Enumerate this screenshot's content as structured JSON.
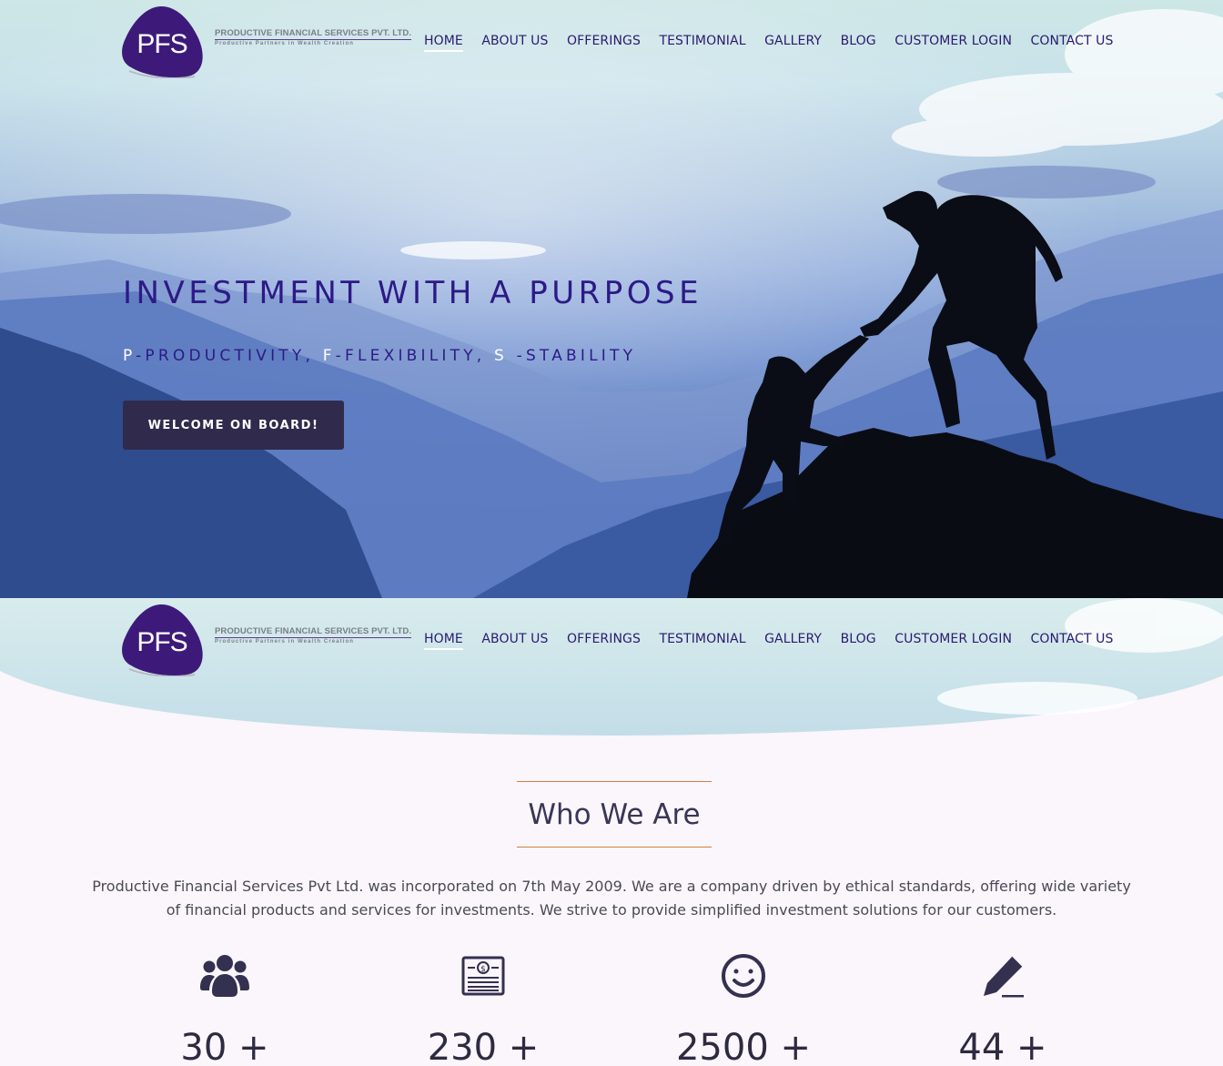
{
  "brand": {
    "logo_text": "PFS",
    "company_name": "PRODUCTIVE FINANCIAL SERVICES PVT. LTD.",
    "tagline": "Productive Partners in Wealth Creation",
    "colors": {
      "logo_purple": "#3d1a7a",
      "nav_text": "#2a1a6e",
      "accent_orange": "#d47f3a",
      "button_dark": "#302b4c"
    }
  },
  "nav": {
    "items": [
      {
        "label": "HOME",
        "active": true
      },
      {
        "label": "ABOUT US"
      },
      {
        "label": "OFFERINGS"
      },
      {
        "label": "TESTIMONIAL"
      },
      {
        "label": "GALLERY"
      },
      {
        "label": "BLOG"
      },
      {
        "label": "CUSTOMER LOGIN"
      },
      {
        "label": "CONTACT US"
      }
    ]
  },
  "hero": {
    "title": "INVESTMENT WITH A PURPOSE",
    "subtitle": {
      "p_letter": "P",
      "p_rest": "-PRODUCTIVITY,",
      "f_letter": "F",
      "f_rest": "-FLEXIBILITY,",
      "s_letter": "S",
      "s_rest": "-STABILITY"
    },
    "cta_label": "WELCOME ON BOARD!"
  },
  "who": {
    "title": "Who We Are",
    "text": "Productive Financial Services Pvt Ltd. was incorporated on 7th May 2009. We are a company driven by ethical standards, offering wide variety of financial products and services for investments. We strive to provide simplified investment solutions for our customers."
  },
  "stats": [
    {
      "icon": "users-icon",
      "value": "30 +"
    },
    {
      "icon": "money-bill-icon",
      "value": "230 +"
    },
    {
      "icon": "smile-icon",
      "value": "2500 +"
    },
    {
      "icon": "pencil-icon",
      "value": "44 +"
    }
  ]
}
